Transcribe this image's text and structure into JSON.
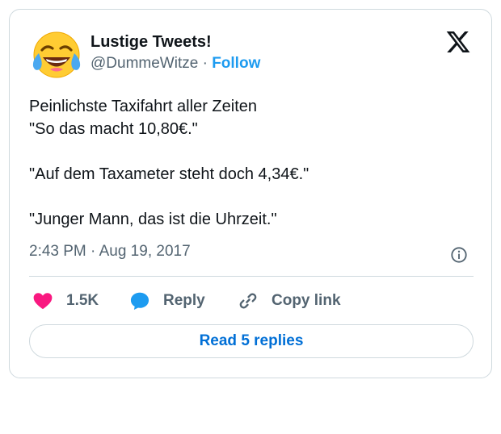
{
  "author": {
    "display_name": "Lustige Tweets!",
    "handle": "@DummeWitze",
    "separator": " · ",
    "follow_label": "Follow",
    "avatar_icon": "face-with-tears-of-joy-emoji"
  },
  "brand_icon": "x-logo-icon",
  "tweet": {
    "lines": [
      "Peinlichste Taxifahrt aller Zeiten",
      "\"So das macht 10,80€.\"",
      "\"Auf dem Taxameter steht doch 4,34€.\"",
      "\"Junger Mann, das ist die Uhrzeit.\""
    ],
    "timestamp": "2:43 PM · Aug 19, 2017"
  },
  "actions": {
    "like_count": "1.5K",
    "reply_label": "Reply",
    "copy_label": "Copy link"
  },
  "read_replies_label": "Read 5 replies",
  "colors": {
    "like": "#f91880",
    "reply": "#1d9bf0",
    "link_blue": "#006fd6",
    "follow_blue": "#1d9bf0",
    "muted": "#536471",
    "border": "#cfd9de"
  }
}
